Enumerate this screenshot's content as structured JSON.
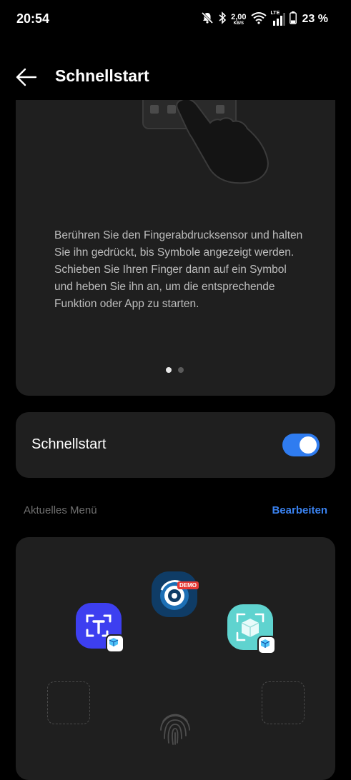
{
  "status_bar": {
    "time": "20:54",
    "net_speed_value": "2,00",
    "net_speed_unit": "KB/S",
    "network_type": "LTE",
    "battery": "23 %"
  },
  "app_bar": {
    "title": "Schnellstart"
  },
  "intro": {
    "description": "Berühren Sie den Fingerabdrucksensor und halten Sie ihn gedrückt, bis Symbole angezeigt werden. Schieben Sie Ihren Finger dann auf ein Symbol und heben Sie ihn an, um die entsprechende Funktion oder App zu starten.",
    "page_count": 2,
    "active_page": 1
  },
  "quick_launch": {
    "label": "Schnellstart",
    "enabled": true
  },
  "current_menu": {
    "title": "Aktuelles Menü",
    "edit_label": "Bearbeiten",
    "demo_badge": "DEMO"
  },
  "colors": {
    "accent": "#2f7cf0",
    "link": "#3a82f0",
    "card": "#1f1f1f"
  }
}
